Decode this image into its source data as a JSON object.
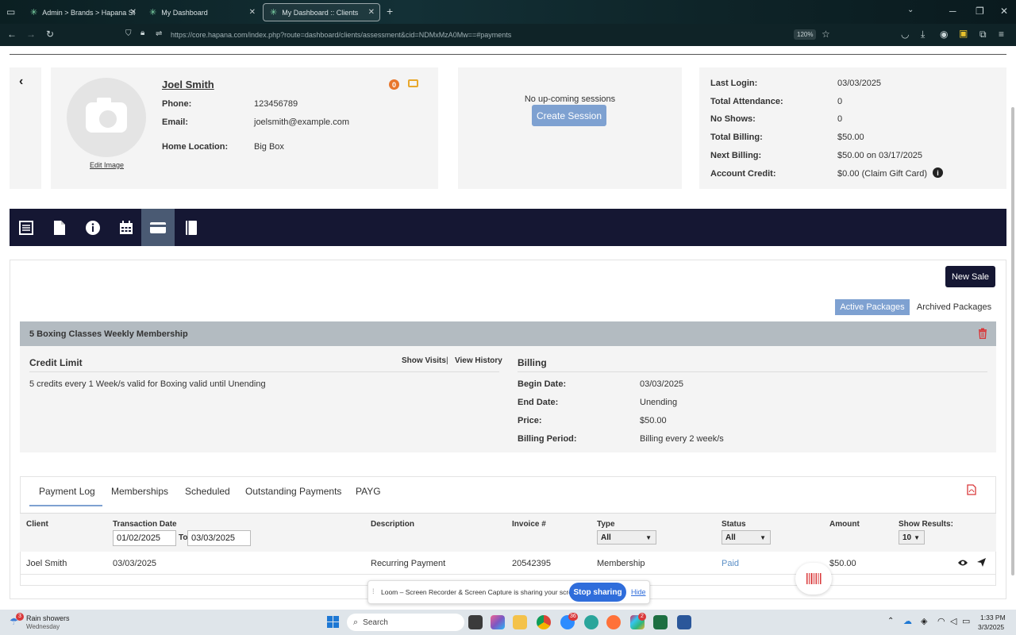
{
  "browser": {
    "tabs": [
      {
        "label": "Admin > Brands > Hapana Stu"
      },
      {
        "label": "My Dashboard"
      },
      {
        "label": "My Dashboard :: Clients"
      }
    ],
    "url": "https://core.hapana.com/index.php?route=dashboard/clients/assessment&cid=NDMxMzA0Mw==#payments",
    "zoom": "120%",
    "extension_badge": "30"
  },
  "client": {
    "name": "Joel Smith",
    "edit_image_label": "Edit Image",
    "phone_label": "Phone:",
    "phone": "123456789",
    "email_label": "Email:",
    "email": "joelsmith@example.com",
    "location_label": "Home Location:",
    "location": "Big Box",
    "badge_count": "0"
  },
  "sessions": {
    "empty_text": "No up-coming sessions",
    "create_label": "Create Session"
  },
  "stats": [
    {
      "label": "Last Login:",
      "value": "03/03/2025"
    },
    {
      "label": "Total Attendance:",
      "value": "0"
    },
    {
      "label": "No Shows:",
      "value": "0"
    },
    {
      "label": "Total Billing:",
      "value": "$50.00"
    },
    {
      "label": "Next Billing:",
      "value": "$50.00 on 03/17/2025"
    },
    {
      "label": "Account Credit:",
      "value": "$0.00 (Claim Gift Card)"
    }
  ],
  "actions": {
    "new_sale": "New Sale",
    "active_packages": "Active Packages",
    "archived_packages": "Archived Packages"
  },
  "package": {
    "title": "5 Boxing Classes Weekly Membership",
    "credit_limit_label": "Credit Limit",
    "show_visits": "Show Visits",
    "separator": "|",
    "view_history": "View History",
    "credit_text": "5 credits every 1 Week/s valid for Boxing valid until Unending",
    "billing_label": "Billing",
    "billing": [
      {
        "label": "Begin Date:",
        "value": "03/03/2025"
      },
      {
        "label": "End Date:",
        "value": "Unending"
      },
      {
        "label": "Price:",
        "value": "$50.00"
      },
      {
        "label": "Billing Period:",
        "value": "Billing every 2 week/s"
      }
    ]
  },
  "log_tabs": [
    "Payment Log",
    "Memberships",
    "Scheduled",
    "Outstanding Payments",
    "PAYG"
  ],
  "table": {
    "headers": {
      "client": "Client",
      "date": "Transaction Date",
      "description": "Description",
      "invoice": "Invoice #",
      "type": "Type",
      "status": "Status",
      "amount": "Amount",
      "results": "Show Results:"
    },
    "filters": {
      "date_from": "01/02/2025",
      "to_label": "To",
      "date_to": "03/03/2025",
      "type": "All",
      "status": "All",
      "results": "10"
    },
    "rows": [
      {
        "client": "Joel Smith",
        "date": "03/03/2025",
        "description": "Recurring Payment",
        "invoice": "20542395",
        "type": "Membership",
        "status": "Paid",
        "amount": "$50.00"
      }
    ]
  },
  "loom": {
    "text": "Loom – Screen Recorder & Screen Capture is sharing your screen.",
    "stop": "Stop sharing",
    "hide": "Hide"
  },
  "taskbar": {
    "weather_badge": "3",
    "weather_title": "Rain showers",
    "weather_sub": "Wednesday",
    "search": "Search",
    "time": "1:33 PM",
    "date": "3/3/2025",
    "badge_teams": "36",
    "badge_slack": "2"
  },
  "colors": {
    "nav_dark": "#151733",
    "accent_blue": "#7ea1d1",
    "status_paid": "#5b8fc7",
    "badge_orange": "#e8762c",
    "danger_red": "#d9383a"
  }
}
